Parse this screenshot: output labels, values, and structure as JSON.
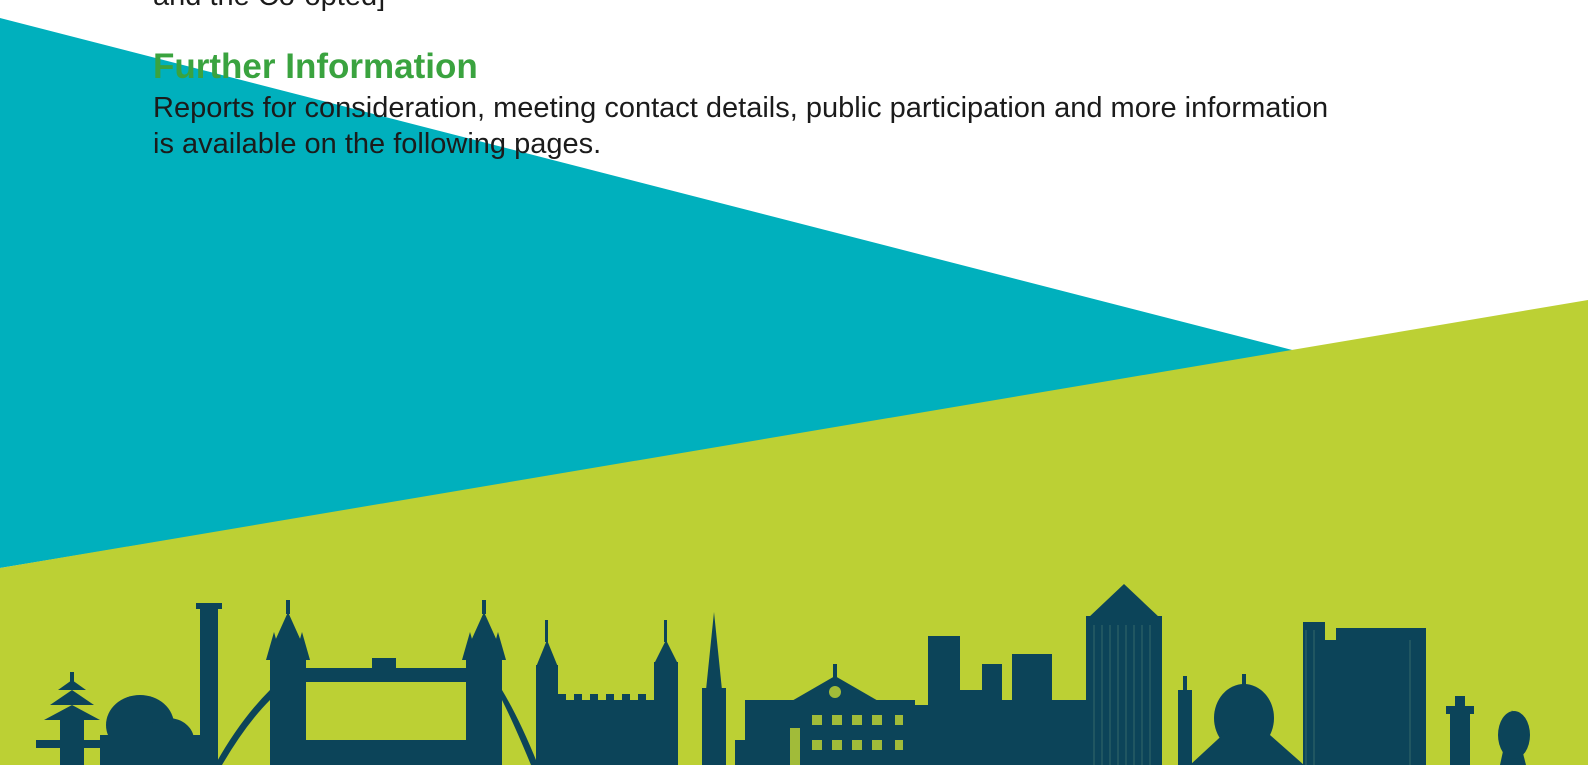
{
  "document": {
    "cut_text": "and the Co-opted]",
    "heading": "Further Information",
    "paragraph": "Reports for consideration, meeting contact details, public participation and more information is available on the following pages."
  },
  "colors": {
    "teal": "#00b0bd",
    "lime": "#bcd034",
    "skyline": "#0c4459",
    "heading_green": "#3aa33f",
    "body_text": "#1b1b1b"
  },
  "skyline_picture": "london-skyline-silhouette"
}
